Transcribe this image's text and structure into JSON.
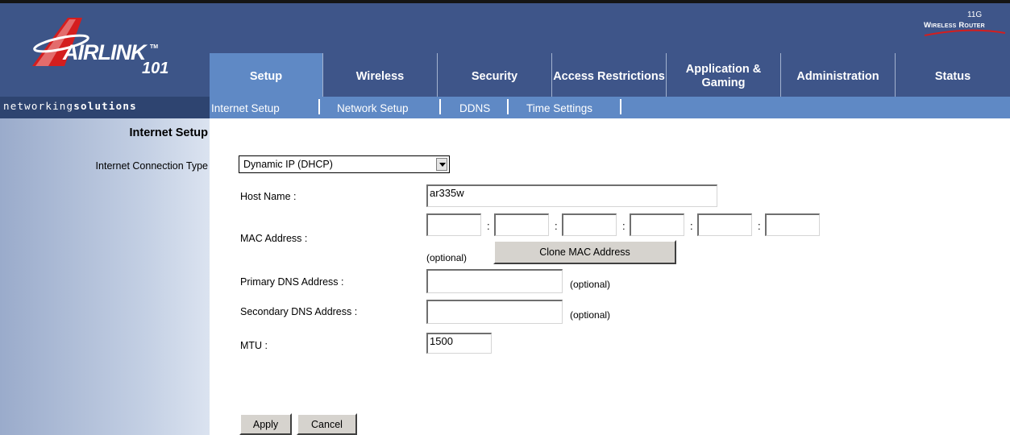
{
  "brand": {
    "airlink": "AIRLINK",
    "tm": "TM",
    "model": "101",
    "tagline_a": "networking",
    "tagline_b": "solutions",
    "badge_g": "11G",
    "badge_router": "Wireless Router"
  },
  "nav": {
    "tabs": [
      {
        "label": "Setup",
        "active": true
      },
      {
        "label": "Wireless"
      },
      {
        "label": "Security"
      },
      {
        "label": "Access Restrictions"
      },
      {
        "label": "Application & Gaming"
      },
      {
        "label": "Administration"
      },
      {
        "label": "Status"
      }
    ],
    "subtabs": [
      "Internet Setup",
      "Network Setup",
      "DDNS",
      "Time Settings"
    ]
  },
  "sidebar": {
    "section_title": "Internet Setup",
    "connection_label": "Internet Connection Type"
  },
  "form": {
    "connection_type": "Dynamic IP (DHCP)",
    "host_name_label": "Host Name :",
    "host_name_value": "ar335w",
    "mac_label": "MAC Address :",
    "mac_values": [
      "",
      "",
      "",
      "",
      "",
      ""
    ],
    "mac_optional": "(optional)",
    "clone_button": "Clone MAC Address",
    "primary_dns_label": "Primary DNS Address :",
    "primary_dns_value": "",
    "primary_dns_optional": "(optional)",
    "secondary_dns_label": "Secondary DNS Address :",
    "secondary_dns_value": "",
    "secondary_dns_optional": "(optional)",
    "mtu_label": "MTU :",
    "mtu_value": "1500",
    "colon": ":"
  },
  "buttons": {
    "apply": "Apply",
    "cancel": "Cancel"
  },
  "colors": {
    "header_blue": "#3e5589",
    "active_blue": "#5f89c5",
    "tagline_bar": "#2e4470",
    "logo_red": "#d41e1e"
  }
}
